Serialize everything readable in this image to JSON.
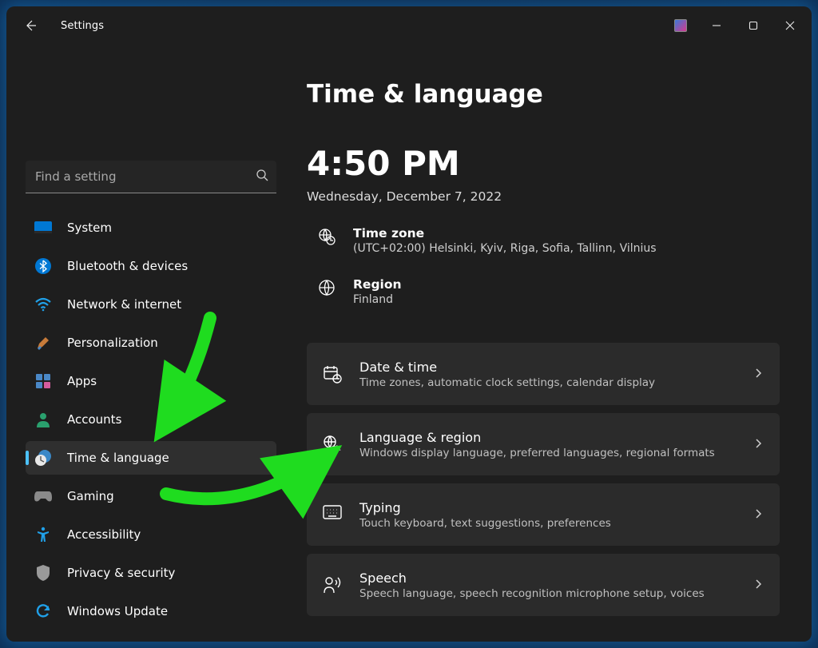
{
  "window": {
    "app_title": "Settings"
  },
  "search": {
    "placeholder": "Find a setting"
  },
  "nav": {
    "items": [
      {
        "label": "System"
      },
      {
        "label": "Bluetooth & devices"
      },
      {
        "label": "Network & internet"
      },
      {
        "label": "Personalization"
      },
      {
        "label": "Apps"
      },
      {
        "label": "Accounts"
      },
      {
        "label": "Time & language"
      },
      {
        "label": "Gaming"
      },
      {
        "label": "Accessibility"
      },
      {
        "label": "Privacy & security"
      },
      {
        "label": "Windows Update"
      }
    ]
  },
  "page": {
    "title": "Time & language",
    "clock": "4:50 PM",
    "date": "Wednesday, December 7, 2022",
    "timezone": {
      "label": "Time zone",
      "value": "(UTC+02:00) Helsinki, Kyiv, Riga, Sofia, Tallinn, Vilnius"
    },
    "region": {
      "label": "Region",
      "value": "Finland"
    },
    "cards": [
      {
        "title": "Date & time",
        "subtitle": "Time zones, automatic clock settings, calendar display"
      },
      {
        "title": "Language & region",
        "subtitle": "Windows display language, preferred languages, regional formats"
      },
      {
        "title": "Typing",
        "subtitle": "Touch keyboard, text suggestions, preferences"
      },
      {
        "title": "Speech",
        "subtitle": "Speech language, speech recognition microphone setup, voices"
      }
    ]
  },
  "annotation": {
    "arrow1_target": "Time & language nav item",
    "arrow2_target": "Language & region card",
    "color": "#22dd22"
  }
}
